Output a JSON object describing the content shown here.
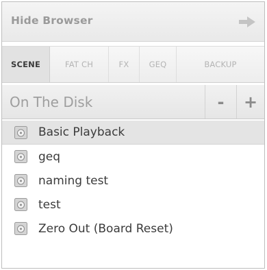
{
  "header": {
    "title": "Hide Browser",
    "arrow_icon": "arrow-right-icon"
  },
  "tabs": [
    {
      "label": "SCENE",
      "active": true
    },
    {
      "label": "FAT CH",
      "active": false
    },
    {
      "label": "FX",
      "active": false
    },
    {
      "label": "GEQ",
      "active": false
    },
    {
      "label": "BACKUP",
      "active": false
    }
  ],
  "disk_bar": {
    "label": "On The Disk",
    "minus_label": "-",
    "plus_label": "+"
  },
  "files": [
    {
      "label": "Basic Playback",
      "selected": true
    },
    {
      "label": "geq",
      "selected": false
    },
    {
      "label": "naming test",
      "selected": false
    },
    {
      "label": "test",
      "selected": false
    },
    {
      "label": "Zero Out (Board Reset)",
      "selected": false
    }
  ],
  "colors": {
    "accent_text": "#3b3b3b",
    "muted_text": "#9e9e9e",
    "selected_row": "#e4e4e4"
  }
}
